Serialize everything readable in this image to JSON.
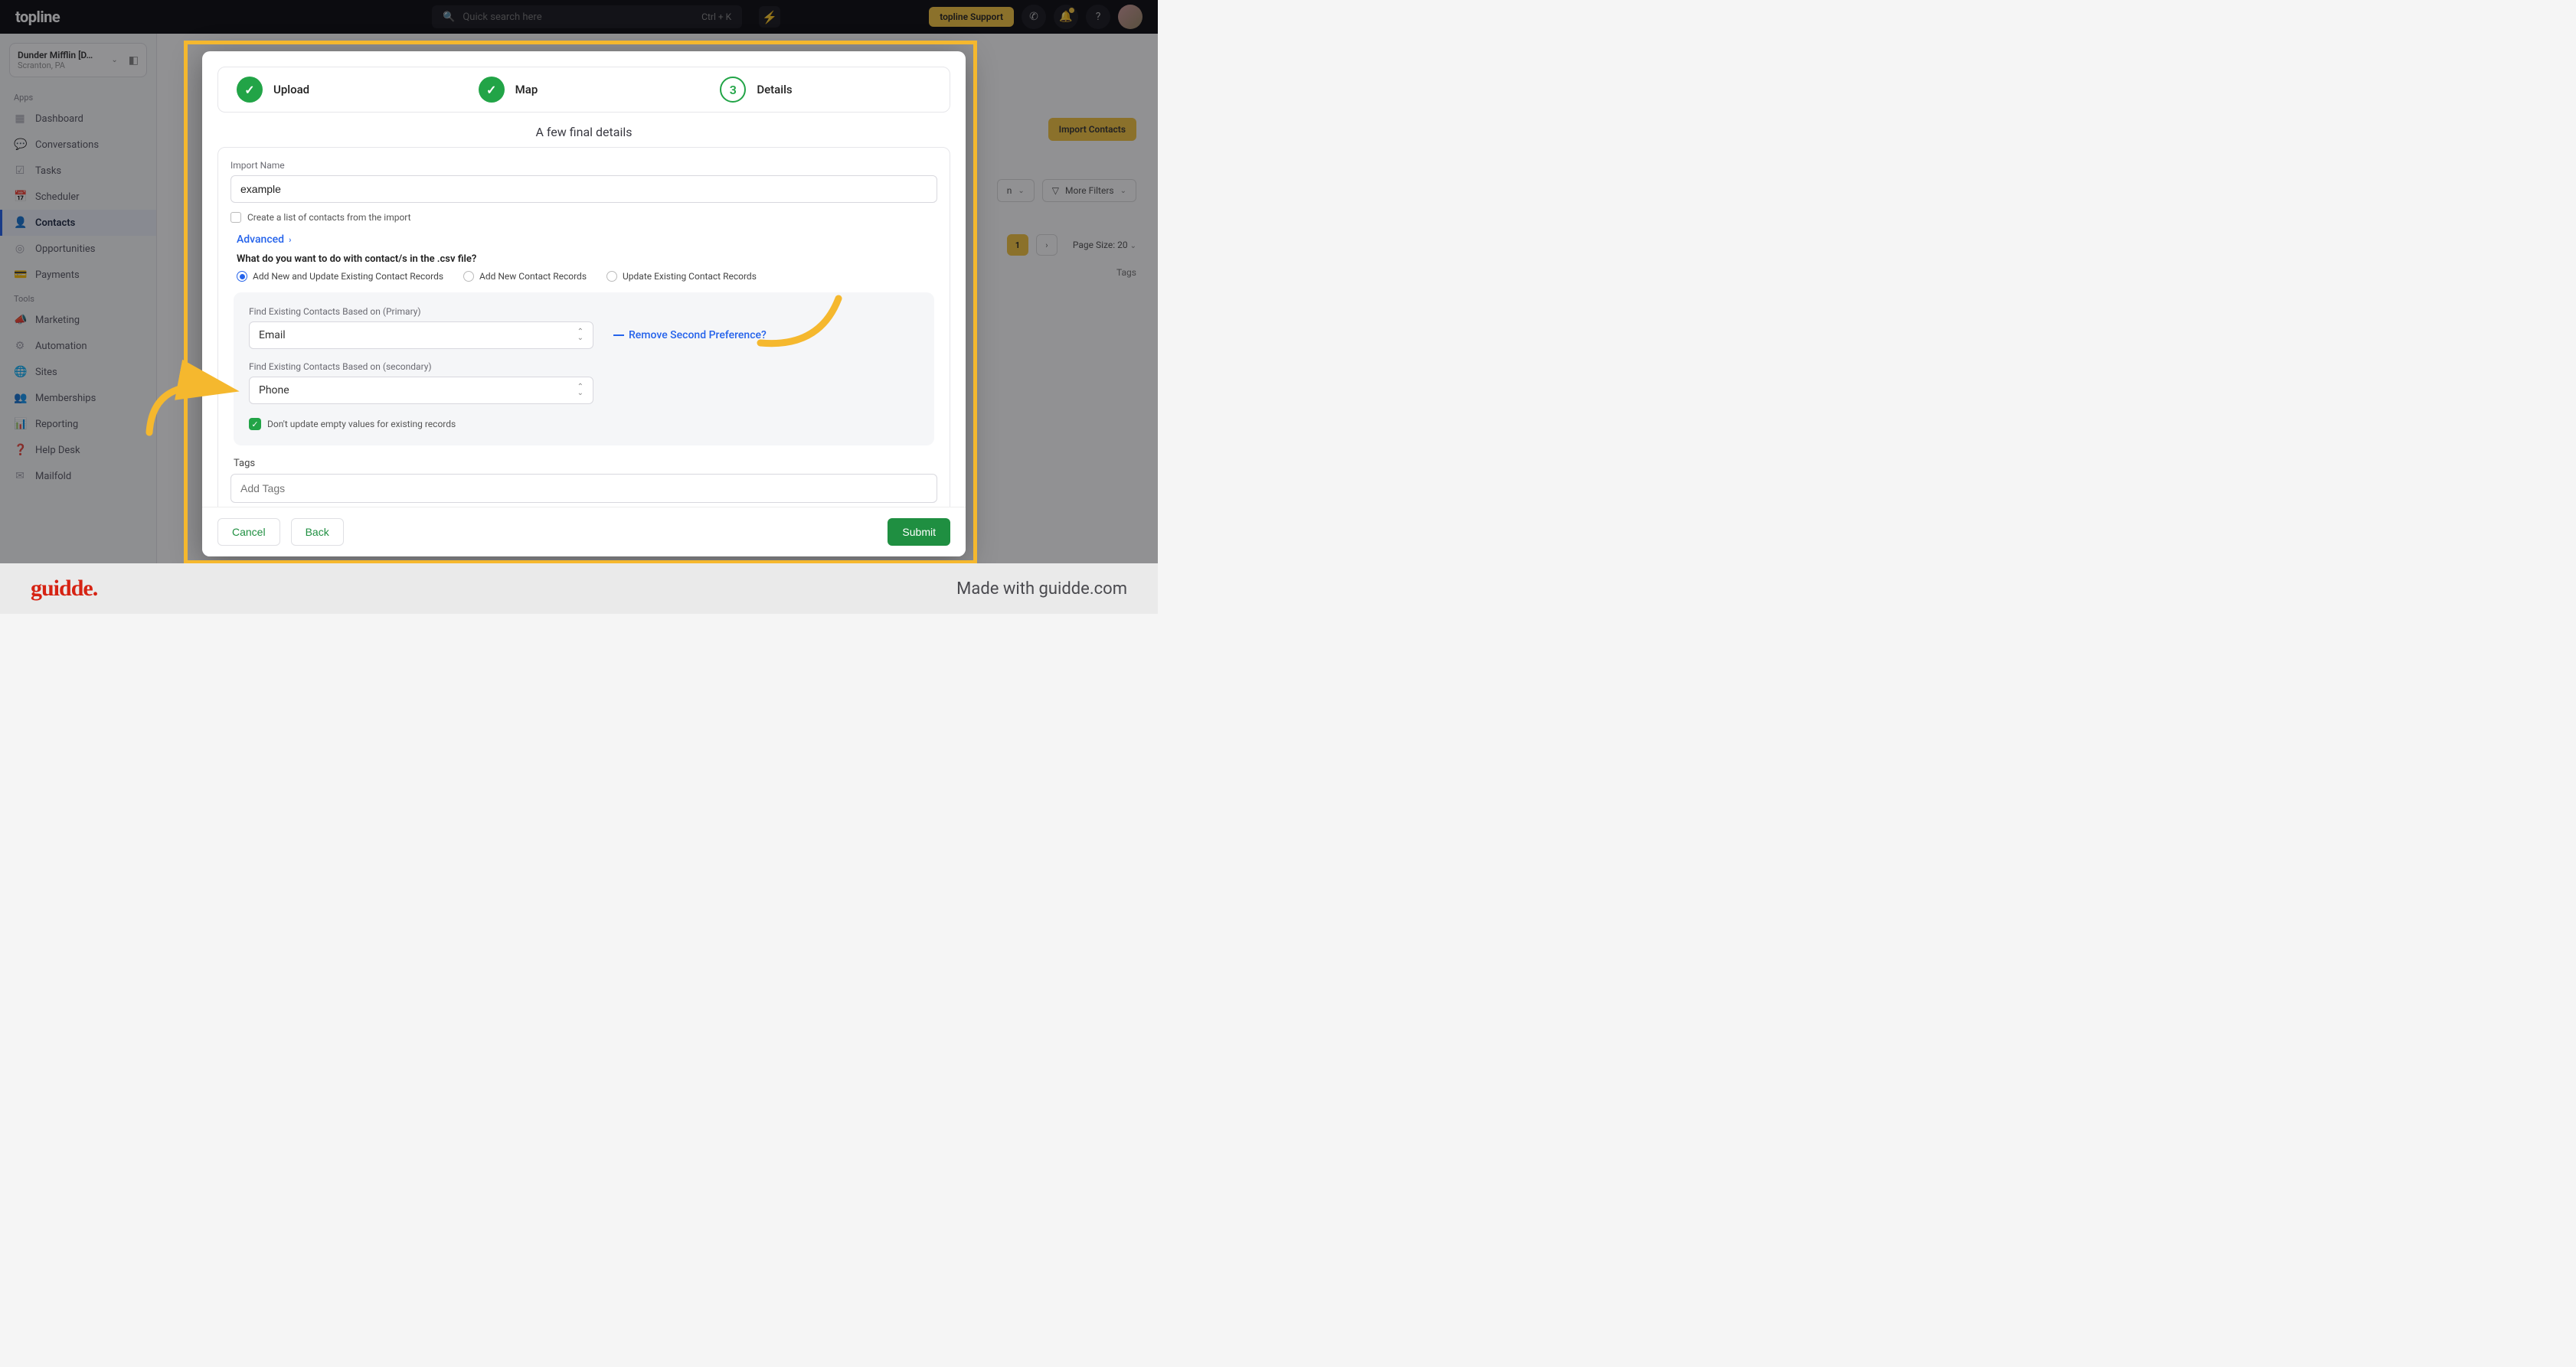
{
  "topbar": {
    "logo": "topline",
    "search_placeholder": "Quick search here",
    "shortcut": "Ctrl + K",
    "support_label": "topline Support"
  },
  "org": {
    "name": "Dunder Mifflin [D…",
    "location": "Scranton, PA"
  },
  "sidebar": {
    "section_apps": "Apps",
    "section_tools": "Tools",
    "apps": [
      {
        "label": "Dashboard",
        "icon": "▦"
      },
      {
        "label": "Conversations",
        "icon": "💬"
      },
      {
        "label": "Tasks",
        "icon": "☑"
      },
      {
        "label": "Scheduler",
        "icon": "📅"
      },
      {
        "label": "Contacts",
        "icon": "👤",
        "active": true
      },
      {
        "label": "Opportunities",
        "icon": "◎"
      },
      {
        "label": "Payments",
        "icon": "💳"
      }
    ],
    "tools": [
      {
        "label": "Marketing",
        "icon": "📣"
      },
      {
        "label": "Automation",
        "icon": "⚙"
      },
      {
        "label": "Sites",
        "icon": "🌐"
      },
      {
        "label": "Memberships",
        "icon": "👥"
      },
      {
        "label": "Reporting",
        "icon": "📊"
      },
      {
        "label": "Help Desk",
        "icon": "❓"
      },
      {
        "label": "Mailfold",
        "icon": "✉"
      }
    ]
  },
  "bg": {
    "import_contacts": "Import Contacts",
    "more_filters": "More Filters",
    "n_dropdown": "n",
    "pager_current": "1",
    "page_size": "Page Size: 20",
    "tags_col": "Tags"
  },
  "modal": {
    "steps": {
      "upload": "Upload",
      "map": "Map",
      "details_num": "3",
      "details": "Details"
    },
    "subtitle": "A few final details",
    "import_name_label": "Import Name",
    "import_name_value": "example",
    "create_list_label": "Create a list of contacts from the import",
    "advanced": "Advanced",
    "radio_title": "What do you want to do with contact/s in the .csv file?",
    "radio_opts": {
      "a": "Add New and Update Existing Contact Records",
      "b": "Add New Contact Records",
      "c": "Update Existing Contact Records"
    },
    "primary_label": "Find Existing Contacts Based on (Primary)",
    "primary_value": "Email",
    "remove_second": "Remove Second Preference?",
    "secondary_label": "Find Existing Contacts Based on (secondary)",
    "secondary_value": "Phone",
    "dont_update": "Don't update empty values for existing records",
    "tags_label": "Tags",
    "tags_placeholder": "Add Tags",
    "cancel": "Cancel",
    "back": "Back",
    "submit": "Submit"
  },
  "footer": {
    "logo": "guidde",
    "made": "Made with guidde.com"
  }
}
